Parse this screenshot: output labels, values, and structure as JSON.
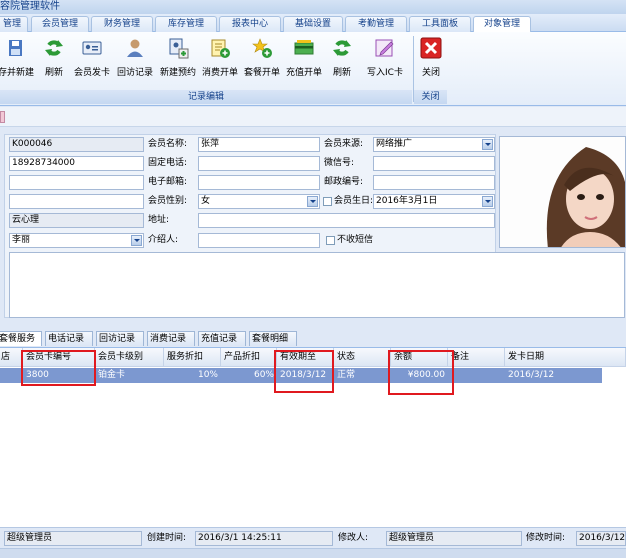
{
  "window": {
    "title": "容院管理软件"
  },
  "menu": {
    "tabs": [
      "管理",
      "会员管理",
      "财务管理",
      "库存管理",
      "报表中心",
      "基础设置",
      "考勤管理",
      "工具面板",
      "对象管理"
    ]
  },
  "ribbon": {
    "buttons": [
      {
        "label": "存并新建",
        "icon": "save-new-icon"
      },
      {
        "label": "刷新",
        "icon": "refresh-icon"
      },
      {
        "label": "会员发卡",
        "icon": "card-issue-icon"
      },
      {
        "label": "回访记录",
        "icon": "user-visit-icon"
      },
      {
        "label": "新建预约",
        "icon": "new-appointment-icon"
      },
      {
        "label": "消费开单",
        "icon": "consume-order-icon"
      },
      {
        "label": "套餐开单",
        "icon": "package-order-icon"
      },
      {
        "label": "充值开单",
        "icon": "recharge-order-icon"
      },
      {
        "label": "刷新",
        "icon": "refresh-icon"
      },
      {
        "label": "写入IC卡",
        "icon": "write-card-icon"
      },
      {
        "label": "关闭",
        "icon": "close-icon"
      }
    ],
    "group_edit": "记录编辑",
    "group_close": "关闭"
  },
  "form": {
    "member_no": "K000046",
    "phone": "18928734000",
    "store": "云心理",
    "staff": "李丽",
    "name_label": "会员名称:",
    "name": "张萍",
    "tel_label": "固定电话:",
    "email_label": "电子邮箱:",
    "gender_label": "会员性别:",
    "gender": "女",
    "address_label": "地址:",
    "referrer_label": "介绍人:",
    "source_label": "会员来源:",
    "source": "网络推广",
    "wechat_label": "微信号:",
    "zip_label": "邮政编号:",
    "birthday_label": "会员生日:",
    "birthday": "2016年3月1日",
    "no_sms": "不收短信"
  },
  "subtabs": [
    "套餐服务",
    "电话记录",
    "回访记录",
    "消费记录",
    "充值记录",
    "套餐明细"
  ],
  "table": {
    "headers": [
      "店",
      "会员卡编号",
      "会员卡级别",
      "服务折扣",
      "产品折扣",
      "有效期至",
      "状态",
      "余额",
      "备注",
      "发卡日期"
    ],
    "rows": [
      [
        "",
        "3800",
        "铂金卡",
        "10%",
        "60%",
        "2018/3/12",
        "正常",
        "¥800.00",
        "",
        "2016/3/12"
      ]
    ]
  },
  "status": {
    "creator": "超级管理员",
    "created_label": "创建时间:",
    "created": "2016/3/1 14:25:11",
    "modifier_label": "修改人:",
    "modifier": "超级管理员",
    "modified_label": "修改时间:",
    "modified": "2016/3/12"
  },
  "colors": {
    "accent": "#15428b",
    "selection": "#7c98d0",
    "highlight": "#e0191f"
  }
}
